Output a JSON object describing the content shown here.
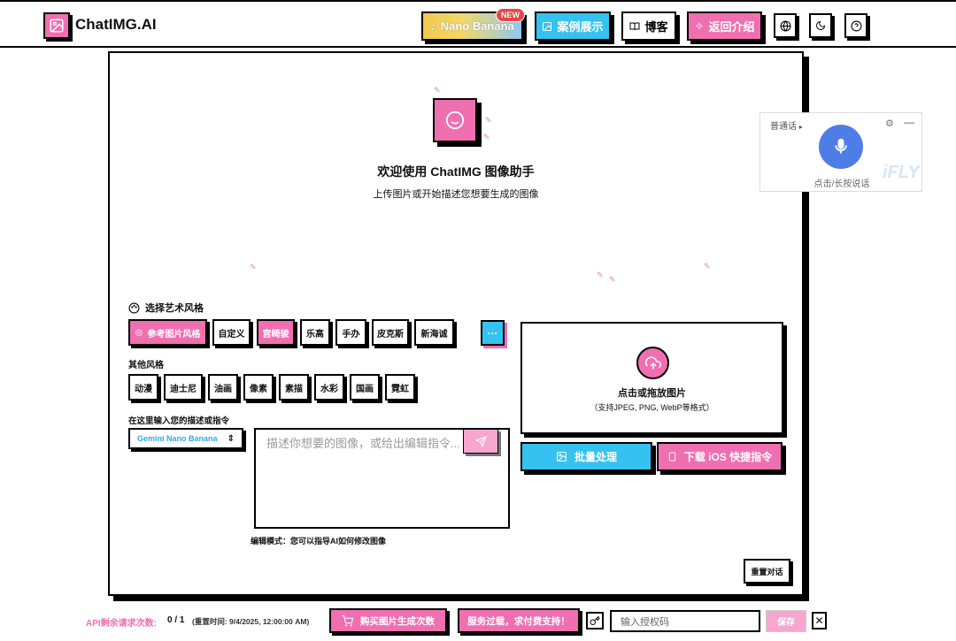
{
  "header": {
    "app_name": "ChatIMG.AI",
    "nano_label": "Nano Banana",
    "new_badge": "NEW",
    "cases_label": "案例展示",
    "blog_label": "博客",
    "back_label": "返回介绍",
    "icons": [
      "globe-icon",
      "moon-icon",
      "help-icon"
    ]
  },
  "welcome": {
    "title": "欢迎使用 ChatIMG 图像助手",
    "subtitle": "上传图片或开始描述您想要生成的图像"
  },
  "styles": {
    "section_title": "选择艺术风格",
    "primary": [
      "参考图片风格",
      "自定义",
      "宫崎骏",
      "乐高",
      "手办",
      "皮克斯",
      "新海诚"
    ],
    "more_label": "···",
    "other_title": "其他风格",
    "other": [
      "动漫",
      "迪士尼",
      "油画",
      "像素",
      "素描",
      "水彩",
      "国画",
      "霓虹"
    ]
  },
  "prompt": {
    "label": "在这里输入您的描述或指令",
    "model": "Gemini Nano Banana",
    "placeholder": "描述你想要的图像，或给出编辑指令...",
    "edit_hint": "编辑模式：您可以指导AI如何修改图像"
  },
  "upload": {
    "title": "点击或拖放图片",
    "subtitle": "（支持JPEG, PNG, WebP等格式）",
    "batch_label": "批量处理",
    "ios_label": "下载 iOS 快捷指令"
  },
  "reset_label": "重置对话",
  "voice": {
    "language": "普通话",
    "hint": "点击/长按说话",
    "brand": "iFLY"
  },
  "footer": {
    "api_label": "API剩余请求次数:",
    "api_count": "0 / 1",
    "reset_time": "(重置时间: 9/4/2025, 12:00:00 AM)",
    "buy_label": "购买图片生成次数",
    "overload_label": "服务过载，求付费支持！",
    "auth_placeholder": "输入授权码",
    "save_label": "保存",
    "close_label": "✕"
  }
}
